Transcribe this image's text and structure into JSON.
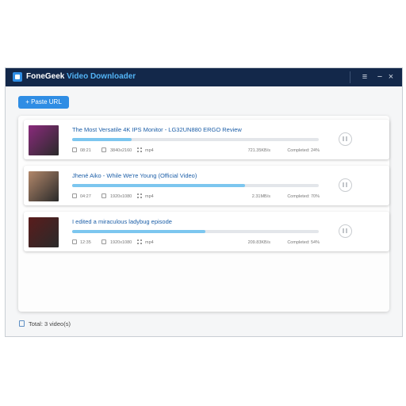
{
  "window": {
    "title_part1": "FoneGeek",
    "title_part2": "Video Downloader",
    "menu_icon": "≡",
    "minimize_icon": "−",
    "close_icon": "×"
  },
  "toolbar": {
    "paste_label": "+ Paste URL"
  },
  "downloads": [
    {
      "title": "The Most Versatile 4K IPS Monitor - LG32UN880 ERGO Review",
      "duration": "08:21",
      "resolution": "3840x2160",
      "format": "mp4",
      "speed": "721.35KB/s",
      "status": "Completed: 24%",
      "progress": 0.24,
      "thumb_color": "#8a2a7c"
    },
    {
      "title": "Jhené Aiko - While We're Young (Official Video)",
      "duration": "04:27",
      "resolution": "1920x1080",
      "format": "mp4",
      "speed": "2.31MB/s",
      "status": "Completed: 70%",
      "progress": 0.7,
      "thumb_color": "#b2876a"
    },
    {
      "title": "I edited a miraculous ladybug episode",
      "duration": "12:35",
      "resolution": "1920x1080",
      "format": "mp4",
      "speed": "209.83KB/s",
      "status": "Completed: 54%",
      "progress": 0.54,
      "thumb_color": "#5a1c1c"
    }
  ],
  "footer": {
    "total": "Total: 3 video(s)"
  },
  "colors": {
    "titlebar": "#13284a",
    "accent": "#2f8de4",
    "progress": "#7cc6ef",
    "title_link": "#1d5fa8"
  }
}
